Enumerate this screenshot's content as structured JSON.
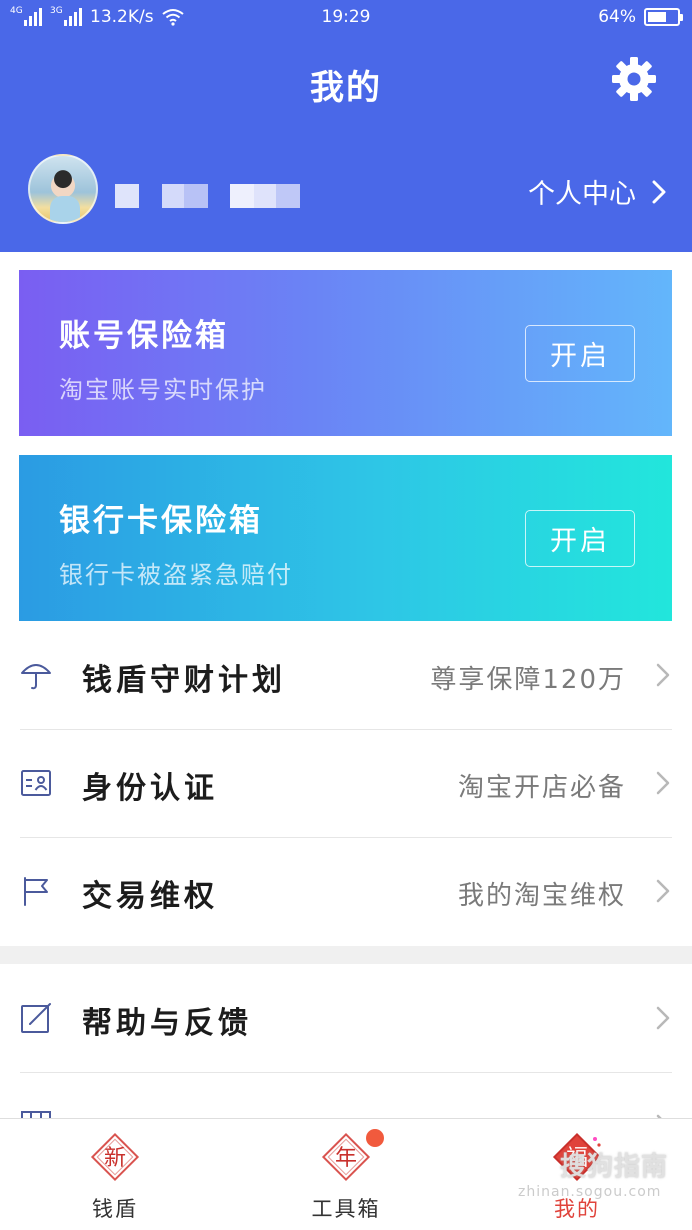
{
  "status_bar": {
    "signal1": "4G",
    "signal2": "3G",
    "speed": "13.2K/s",
    "time": "19:29",
    "battery_text": "64%",
    "battery_level": 0.64
  },
  "header": {
    "title": "我的",
    "profile_link": "个人中心"
  },
  "cards": [
    {
      "title": "账号保险箱",
      "subtitle": "淘宝账号实时保护",
      "button": "开启"
    },
    {
      "title": "银行卡保险箱",
      "subtitle": "银行卡被盗紧急赔付",
      "button": "开启"
    }
  ],
  "menu": [
    {
      "icon": "umbrella-icon",
      "label": "钱盾守财计划",
      "value": "尊享保障120万"
    },
    {
      "icon": "id-card-icon",
      "label": "身份认证",
      "value": "淘宝开店必备"
    },
    {
      "icon": "flag-icon",
      "label": "交易维权",
      "value": "我的淘宝维权"
    },
    {
      "icon": "edit-icon",
      "label": "帮助与反馈",
      "value": ""
    }
  ],
  "tabs": [
    {
      "icon": "xin-badge-icon",
      "icon_char": "新",
      "label": "钱盾"
    },
    {
      "icon": "nian-badge-icon",
      "icon_char": "年",
      "label": "工具箱"
    },
    {
      "icon": "fu-badge-icon",
      "icon_char": "福",
      "label": "我的"
    }
  ],
  "watermark": {
    "line1": "搜狗指南",
    "line2": "zhinan.sogou.com"
  },
  "colors": {
    "header_bg": "#4a68e8",
    "active_tab": "#e0433b",
    "badge_red": "#f15a3d"
  }
}
